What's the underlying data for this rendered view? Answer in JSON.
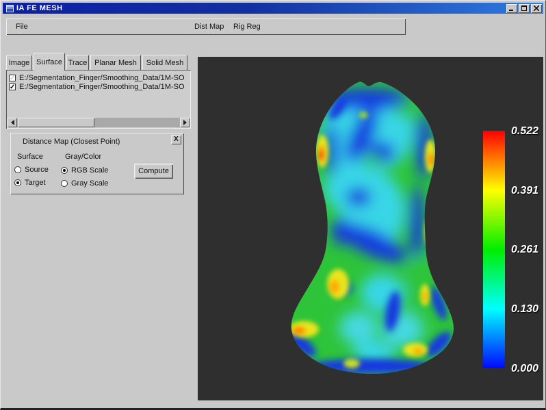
{
  "window": {
    "title": "IA FE MESH",
    "controls": [
      {
        "name": "minimize"
      },
      {
        "name": "maximize"
      },
      {
        "name": "close"
      }
    ]
  },
  "menubar": {
    "items": [
      {
        "label": "File"
      },
      {
        "label": "Dist Map"
      },
      {
        "label": "Rig Reg"
      }
    ]
  },
  "tabs": [
    {
      "label": "Image",
      "active": false
    },
    {
      "label": "Surface",
      "active": true
    },
    {
      "label": "Trace",
      "active": false
    },
    {
      "label": "Planar Mesh",
      "active": false
    },
    {
      "label": "Solid Mesh",
      "active": false
    }
  ],
  "file_list": {
    "items": [
      {
        "checked": false,
        "path": "E:/Segmentation_Finger/Smoothing_Data/1M-SO"
      },
      {
        "checked": true,
        "path": "E:/Segmentation_Finger/Smoothing_Data/1M-SO"
      }
    ]
  },
  "icons": {
    "check_glyph": "✓"
  },
  "distance_map": {
    "title": "Distance Map (Closest Point)",
    "close_label": "X",
    "surface_group_label": "Surface",
    "color_group_label": "Gray/Color",
    "surface_options": [
      {
        "label": "Source",
        "selected": false
      },
      {
        "label": "Target",
        "selected": true
      }
    ],
    "color_options": [
      {
        "label": "RGB Scale",
        "selected": true
      },
      {
        "label": "Gray Scale",
        "selected": false
      }
    ],
    "compute_label": "Compute"
  },
  "viewer": {
    "background": "#2f2f2f",
    "content": "3D finger bone surface colored by closest-point distance map",
    "colorbar": {
      "labels": [
        "0.522",
        "0.391",
        "0.261",
        "0.130",
        "0.000"
      ],
      "stops": [
        "#ff0000",
        "#ffff00",
        "#00ee00",
        "#00ffff",
        "#0008ff"
      ],
      "min": 0.0,
      "max": 0.522
    }
  }
}
